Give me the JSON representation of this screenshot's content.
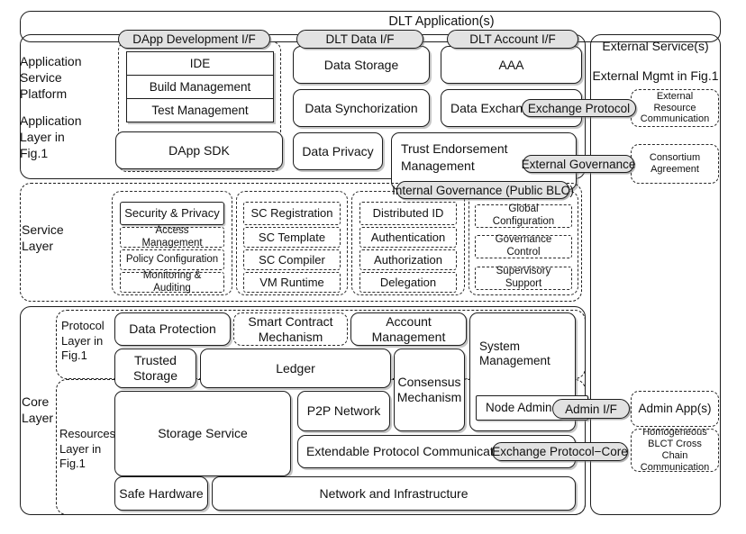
{
  "diagram": {
    "title": "DLT Application(s)",
    "layers": {
      "application_service_platform": "Application\nService\nPlatform",
      "application_layer_fig1": "Application\nLayer in\nFig.1",
      "service_layer": "Service\nLayer",
      "core_layer": "Core\nLayer",
      "protocol_layer_fig1": "Protocol\nLayer in\nFig.1",
      "resources_layer_fig1": "Resources\nLayer in\nFig.1"
    },
    "interfaces": {
      "dapp_development": "DApp Development I/F",
      "dlt_data": "DLT Data I/F",
      "dlt_account": "DLT Account I/F",
      "exchange_protocol": "Exchange Protocol",
      "external_governance": "External Governance",
      "internal_governance": "Internal Governance (Public BLC)",
      "admin_if": "Admin I/F",
      "exchange_protocol_core": "Exchange Protocol−Core"
    },
    "application": {
      "dev_stack": [
        "IDE",
        "Build Management",
        "Test Management"
      ],
      "dapp_sdk": "DApp SDK",
      "data_storage": "Data Storage",
      "data_synchorization": "Data Synchorization",
      "data_privacy": "Data Privacy",
      "aaa": "AAA",
      "data_exchange": "Data Exchange",
      "trust_endorsement": "Trust Endorsement\nManagement"
    },
    "external": {
      "title": "External Service(s)",
      "subtitle": "External Mgmt in Fig.1",
      "resource_comm": "External Resource\nCommunication",
      "consortium": "Consortium\nAgreement",
      "admin_apps": "Admin App(s)",
      "cross_chain": "Homogeneous\nBLCT Cross Chain\nCommunication"
    },
    "service": {
      "group_security": [
        "Security & Privacy",
        "Access Management",
        "Policy Configuration",
        "Monitoring & Auditing"
      ],
      "group_sc": [
        "SC Registration",
        "SC Template",
        "SC Compiler",
        "VM Runtime"
      ],
      "group_identity": [
        "Distributed ID",
        "Authentication",
        "Authorization",
        "Delegation"
      ],
      "group_governance": [
        "Global Configuration",
        "Governance Control",
        "Supervisory Support"
      ]
    },
    "core": {
      "data_protection": "Data Protection",
      "smart_contract_mechanism": "Smart Contract\nMechanism",
      "account_management": "Account Management",
      "trusted_storage": "Trusted\nStorage",
      "ledger": "Ledger",
      "consensus_mechanism": "Consensus\nMechanism",
      "system_management": "System Management",
      "node_admin": "Node Admin",
      "storage_service": "Storage Service",
      "p2p_network": "P2P Network",
      "extendable_protocol_comm": "Extendable Protocol Communication",
      "safe_hardware": "Safe Hardware",
      "network_infrastructure": "Network and Infrastructure"
    },
    "colors": {
      "stroke": "#1d1d1d",
      "pill_fill": "#e2e2e2",
      "page_bg": "#ffffff"
    }
  }
}
